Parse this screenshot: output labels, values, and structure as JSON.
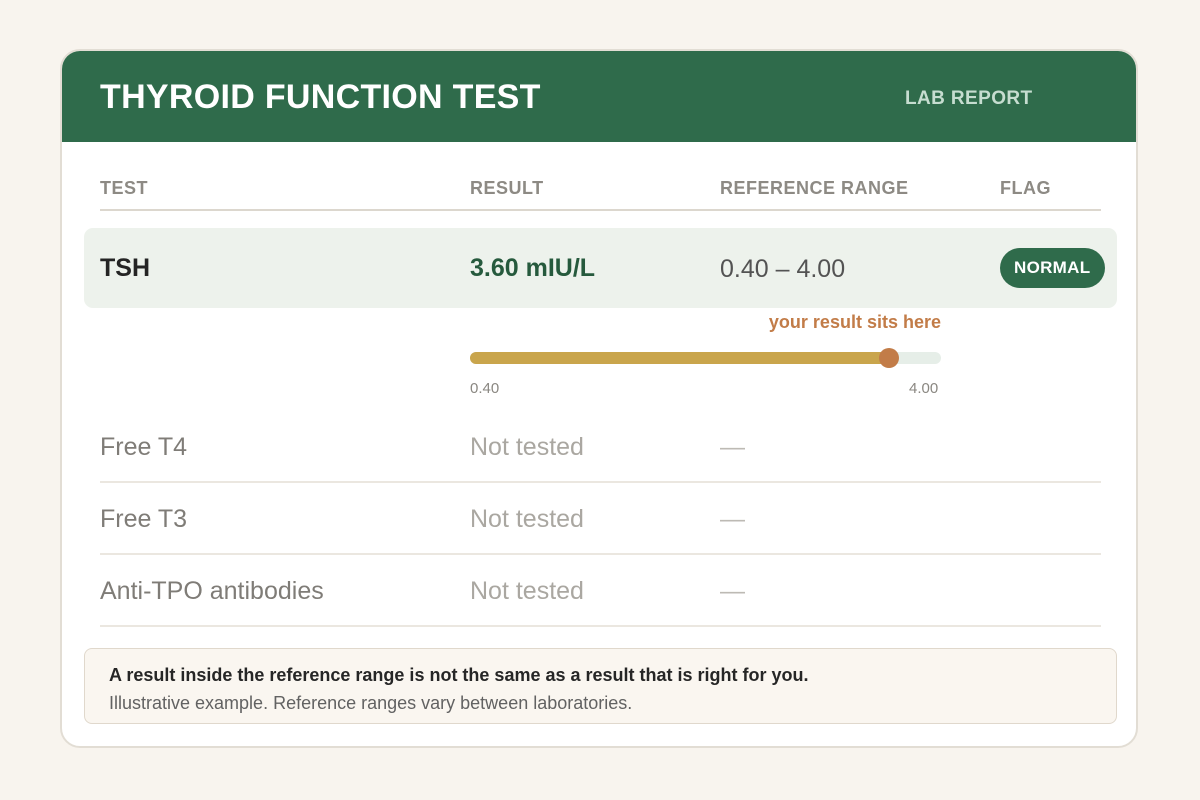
{
  "header": {
    "title": "THYROID FUNCTION TEST",
    "subtitle": "LAB REPORT"
  },
  "columns": {
    "test": "TEST",
    "result": "RESULT",
    "reference_range": "REFERENCE RANGE",
    "flag": "FLAG"
  },
  "tsh": {
    "test": "TSH",
    "result": "3.60 mIU/L",
    "reference_range": "0.40 – 4.00",
    "flag": "NORMAL"
  },
  "gauge": {
    "caption": "your result sits here",
    "min": 0.4,
    "max": 4.0,
    "value": 3.6,
    "min_label": "0.40",
    "max_label": "4.00"
  },
  "other_tests": [
    {
      "test": "Free T4",
      "result": "Not tested",
      "reference_range": "—"
    },
    {
      "test": "Free T3",
      "result": "Not tested",
      "reference_range": "—"
    },
    {
      "test": "Anti-TPO antibodies",
      "result": "Not tested",
      "reference_range": "—"
    }
  ],
  "note": {
    "strong": "A result inside the reference range is not the same as a result that is right for you.",
    "small": "Illustrative example. Reference ranges vary between laboratories."
  },
  "colors": {
    "header": "#2f6b4b",
    "badge": "#2f6b4b",
    "gauge_fill": "#c9a54c",
    "gauge_marker": "#c27c48",
    "gauge_track": "#e6eee8",
    "tsh_row": "#edf2ec"
  }
}
